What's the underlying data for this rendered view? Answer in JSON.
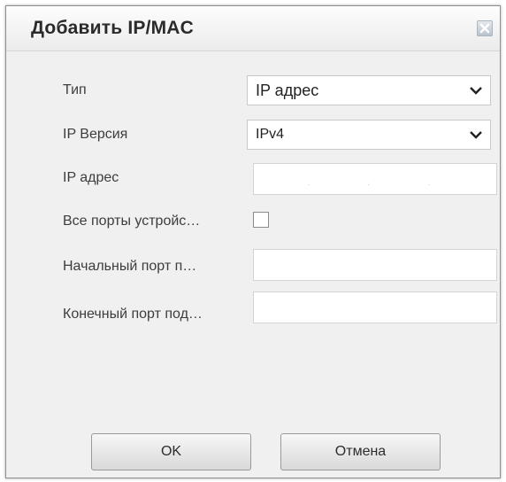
{
  "dialog": {
    "title": "Добавить IP/MAC",
    "close_icon": "close-icon"
  },
  "form": {
    "type": {
      "label": "Тип",
      "value": "IP адрес"
    },
    "ip_version": {
      "label": "IP Версия",
      "value": "IPv4"
    },
    "ip_address": {
      "label": "IP адрес",
      "value": "",
      "separators": [
        ".",
        ".",
        "."
      ]
    },
    "all_ports": {
      "label": "Все порты устройс…",
      "checked": false
    },
    "start_port": {
      "label": "Начальный порт п…",
      "value": ""
    },
    "end_port": {
      "label": "Конечный порт под…",
      "value": ""
    }
  },
  "buttons": {
    "ok": "OK",
    "cancel": "Отмена"
  }
}
